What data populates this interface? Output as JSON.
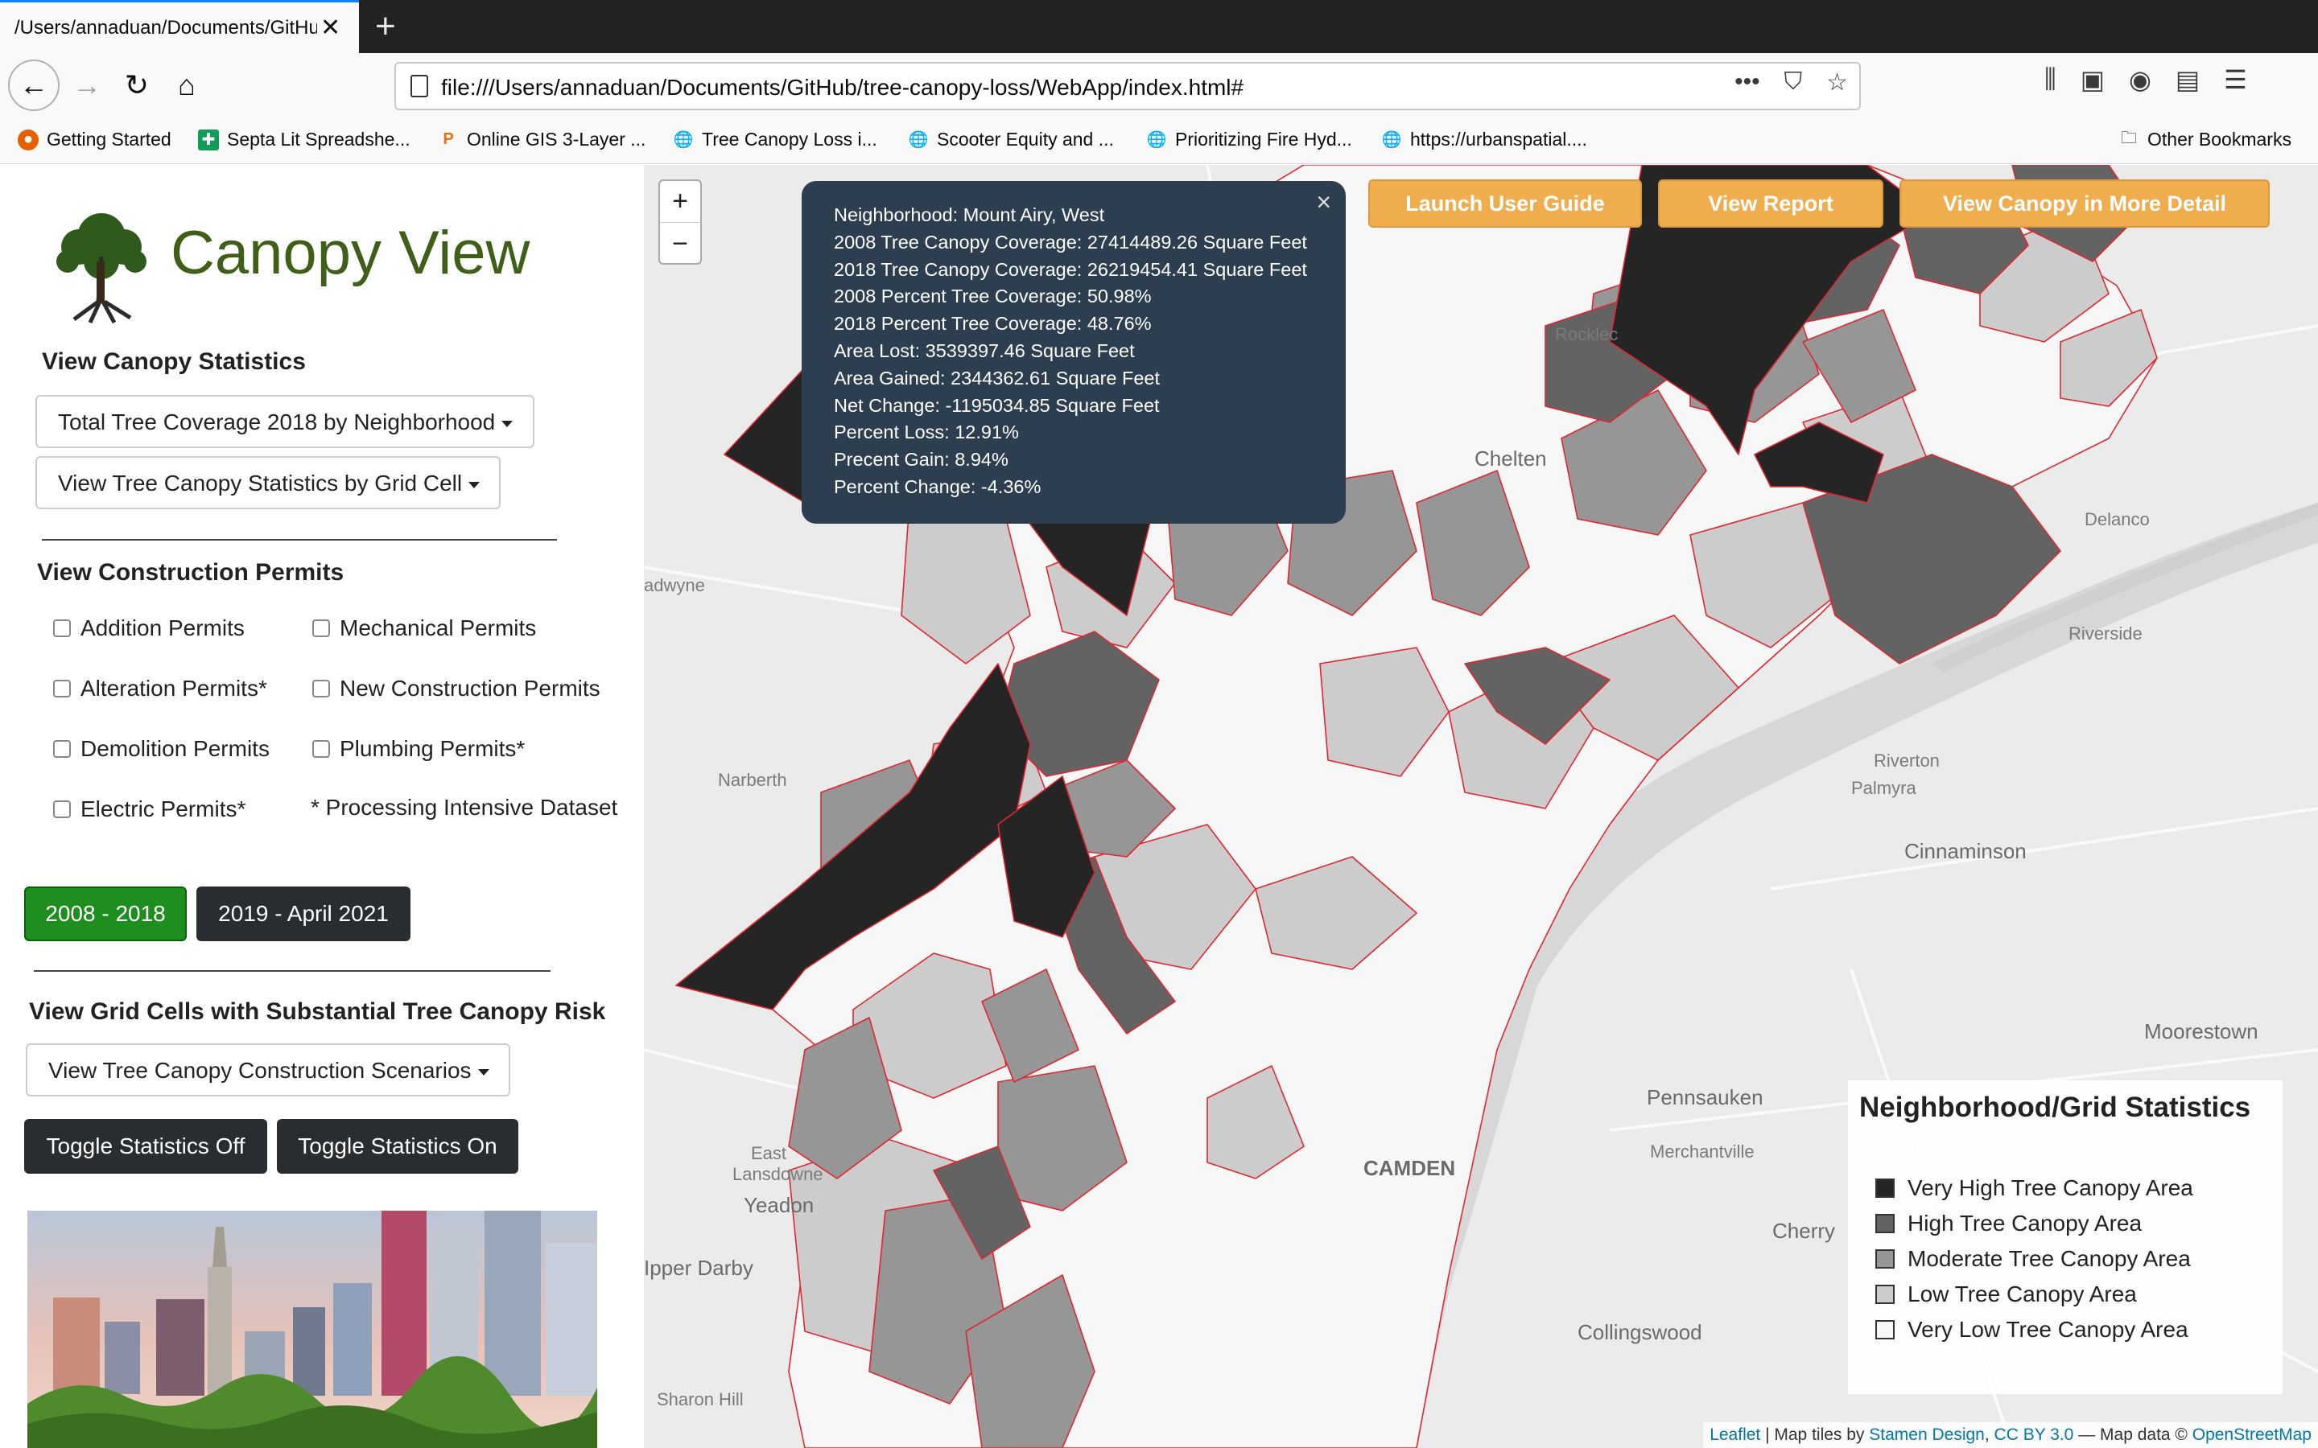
{
  "browser": {
    "tab_title": "/Users/annaduan/Documents/GitHub",
    "url": "file:///Users/annaduan/Documents/GitHub/tree-canopy-loss/WebApp/index.html#",
    "bookmarks": [
      {
        "label": "Getting Started",
        "icon": "firefox-icon"
      },
      {
        "label": "Septa Lit Spreadshe...",
        "icon": "sheets-icon"
      },
      {
        "label": "Online GIS 3-Layer ...",
        "icon": "p-icon"
      },
      {
        "label": "Tree Canopy Loss i...",
        "icon": "globe-icon"
      },
      {
        "label": "Scooter Equity and ...",
        "icon": "globe-icon"
      },
      {
        "label": "Prioritizing Fire Hyd...",
        "icon": "globe-icon"
      },
      {
        "label": "https://urbanspatial....",
        "icon": "globe-icon"
      }
    ],
    "other_bookmarks": "Other Bookmarks"
  },
  "sidebar": {
    "title": "Canopy View",
    "stats_heading": "View Canopy Statistics",
    "dropdown_total": "Total Tree Coverage 2018 by Neighborhood",
    "dropdown_grid": "View Tree Canopy Statistics by Grid Cell",
    "permits_heading": "View Construction Permits",
    "permits_left": [
      "Addition Permits",
      "Alteration Permits*",
      "Demolition Permits",
      "Electric Permits*"
    ],
    "permits_right": [
      "Mechanical Permits",
      "New Construction Permits",
      "Plumbing Permits*"
    ],
    "note": "* Processing Intensive Dataset",
    "period_a": "2008 - 2018",
    "period_b": "2019 - April 2021",
    "risk_heading": "View Grid Cells with Substantial Tree Canopy Risk",
    "dropdown_scenarios": "View Tree Canopy Construction Scenarios",
    "toggle_off": "Toggle Statistics Off",
    "toggle_on": "Toggle Statistics On"
  },
  "map": {
    "zoom_in": "+",
    "zoom_out": "−",
    "buttons": {
      "guide": "Launch User Guide",
      "report": "View Report",
      "detail": "View Canopy in More Detail"
    },
    "popup": {
      "close": "×",
      "lines": [
        "Neighborhood: Mount Airy, West",
        "2008 Tree Canopy Coverage: 27414489.26 Square Feet",
        "2018 Tree Canopy Coverage: 26219454.41 Square Feet",
        "2008 Percent Tree Coverage: 50.98%",
        "2018 Percent Tree Coverage: 48.76%",
        "Area Lost: 3539397.46 Square Feet",
        "Area Gained: 2344362.61 Square Feet",
        "Net Change: -1195034.85 Square Feet",
        "Percent Loss: 12.91%",
        "Precent Gain: 8.94%",
        "Percent Change: -4.36%"
      ]
    },
    "places": [
      "Rocklec",
      "Chelten",
      "Delanco",
      "Riverside",
      "adwyne",
      "Narberth",
      "Riverton",
      "Palmyra",
      "Cinnaminson",
      "Moorestown",
      "Pennsauken",
      "Merchantville",
      "CAMDEN",
      "East Lansdowne",
      "Yeadon",
      "Cherry",
      "Ipper Darby",
      "Collingswood",
      "Sharon Hill"
    ],
    "legend": {
      "title": "Neighborhood/Grid Statistics",
      "items": [
        {
          "label": "Very High Tree Canopy Area",
          "color": "#252525"
        },
        {
          "label": "High Tree Canopy Area",
          "color": "#636363"
        },
        {
          "label": "Moderate Tree Canopy Area",
          "color": "#969696"
        },
        {
          "label": "Low Tree Canopy Area",
          "color": "#cccccc"
        },
        {
          "label": "Very Low Tree Canopy Area",
          "color": "#f7f7f7"
        }
      ]
    },
    "attribution": {
      "leaflet": "Leaflet",
      "tiles_prefix": " | Map tiles by ",
      "stamen": "Stamen Design",
      "sep": ", ",
      "cc": "CC BY 3.0",
      "data_prefix": " — Map data © ",
      "osm": "OpenStreetMap"
    }
  },
  "colors": {
    "accent_green": "#1e8e1e",
    "orange": "#f0ad4e",
    "popup_bg": "#2c3e50",
    "title_green": "#3f5e17"
  }
}
